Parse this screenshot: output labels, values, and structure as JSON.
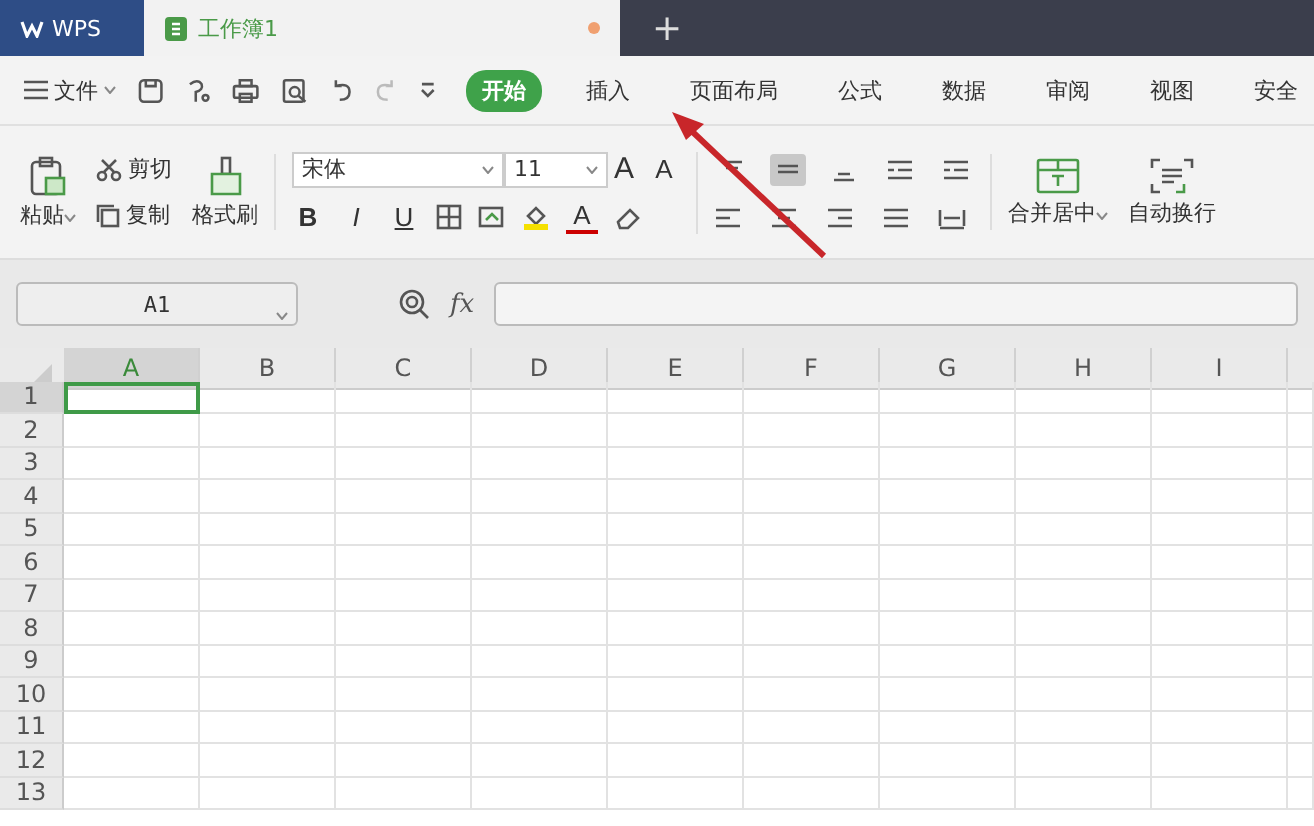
{
  "app_tab": {
    "label": "WPS"
  },
  "doc_tab": {
    "title": "工作簿1",
    "unsaved": true
  },
  "new_tab": "+",
  "menu": {
    "file": "文件",
    "tabs": [
      {
        "label": "开始",
        "selected": true
      },
      {
        "label": "插入",
        "selected": false
      },
      {
        "label": "页面布局",
        "selected": false
      },
      {
        "label": "公式",
        "selected": false
      },
      {
        "label": "数据",
        "selected": false
      },
      {
        "label": "审阅",
        "selected": false
      },
      {
        "label": "视图",
        "selected": false
      },
      {
        "label": "安全",
        "selected": false
      }
    ]
  },
  "ribbon": {
    "paste": "粘贴",
    "cut": "剪切",
    "copy": "复制",
    "format_painter": "格式刷",
    "font": "宋体",
    "size": "11",
    "styles": [
      "B",
      "I",
      "U"
    ],
    "grow": "A",
    "shrink": "A",
    "font_color": "A",
    "merge": "合并居中",
    "wrap": "自动换行"
  },
  "name_box": "A1",
  "fx": "fx",
  "columns": [
    {
      "label": "A",
      "selected": true
    },
    {
      "label": "B",
      "selected": false
    },
    {
      "label": "C",
      "selected": false
    },
    {
      "label": "D",
      "selected": false
    },
    {
      "label": "E",
      "selected": false
    },
    {
      "label": "F",
      "selected": false
    },
    {
      "label": "G",
      "selected": false
    },
    {
      "label": "H",
      "selected": false
    },
    {
      "label": "I",
      "selected": false
    }
  ],
  "rows": [
    {
      "label": "1",
      "selected": true
    },
    {
      "label": "2",
      "selected": false
    },
    {
      "label": "3",
      "selected": false
    },
    {
      "label": "4",
      "selected": false
    },
    {
      "label": "5",
      "selected": false
    },
    {
      "label": "6",
      "selected": false
    },
    {
      "label": "7",
      "selected": false
    },
    {
      "label": "8",
      "selected": false
    },
    {
      "label": "9",
      "selected": false
    },
    {
      "label": "10",
      "selected": false
    },
    {
      "label": "11",
      "selected": false
    },
    {
      "label": "12",
      "selected": false
    },
    {
      "label": "13",
      "selected": false
    }
  ]
}
